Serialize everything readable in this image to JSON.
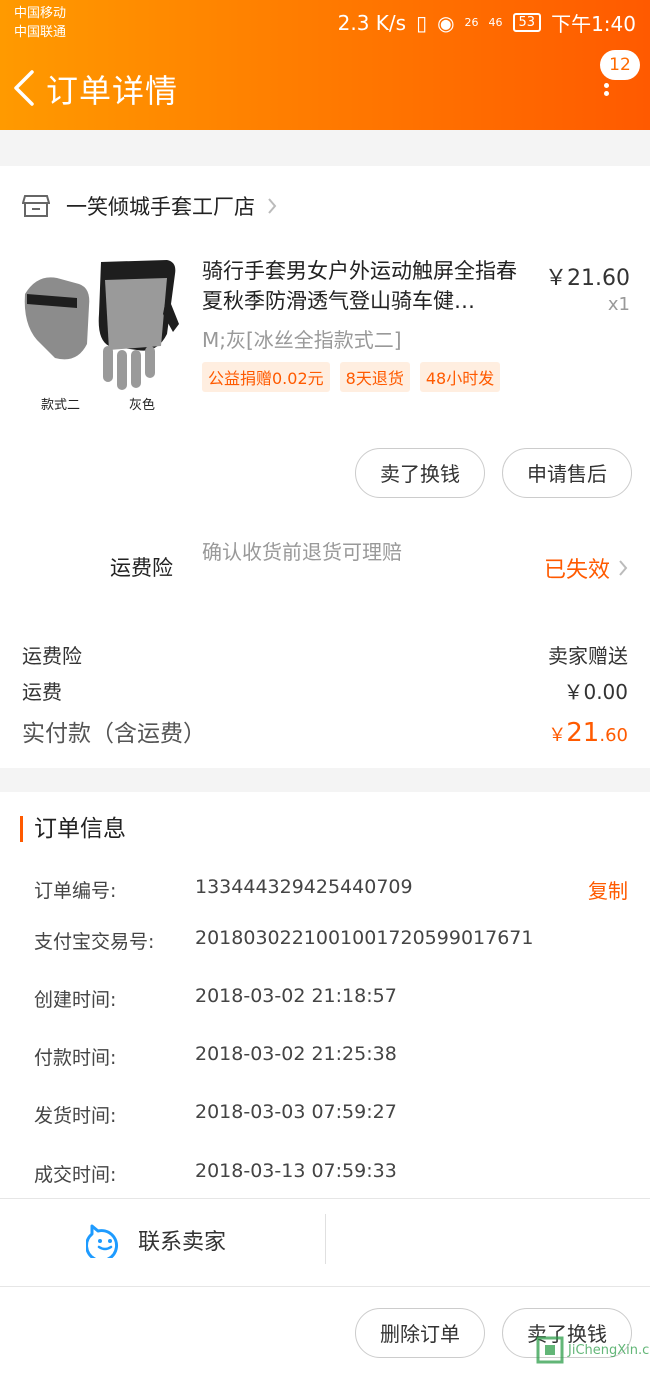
{
  "status_bar": {
    "carrier1": "中国移动",
    "carrier2": "中国联通",
    "speed": "2.3 K/s",
    "signal1": "26",
    "signal2": "46",
    "battery": "53",
    "time": "下午1:40"
  },
  "header": {
    "title": "订单详情",
    "badge": "12"
  },
  "shop": {
    "name": "一笑倾城手套工厂店"
  },
  "item": {
    "title": "骑行手套男女户外运动触屏全指春夏秋季防滑透气登山骑车健…",
    "price": "￥21.60",
    "qty": "x1",
    "spec": "M;灰[冰丝全指款式二]",
    "tags": [
      "公益捐赠0.02元",
      "8天退货",
      "48小时发"
    ],
    "thumb_caption1": "款式二",
    "thumb_caption2": "灰色"
  },
  "actions": {
    "sell": "卖了换钱",
    "after_sale": "申请售后"
  },
  "insurance": {
    "label": "运费险",
    "desc": "确认收货前退货可理赔",
    "status": "已失效"
  },
  "summary": {
    "ins_label": "运费险",
    "ins_val": "卖家赠送",
    "ship_label": "运费",
    "ship_val": "￥0.00",
    "total_label": "实付款（含运费）",
    "total_currency": "￥",
    "total_int": "21",
    "total_dec": ".60"
  },
  "order_info": {
    "heading": "订单信息",
    "copy": "复制",
    "rows": [
      {
        "label": "订单编号:",
        "value": "133444329425440709"
      },
      {
        "label": "支付宝交易号:",
        "value": "2018030221001001720599017671"
      },
      {
        "label": "创建时间:",
        "value": "2018-03-02 21:18:57"
      },
      {
        "label": "付款时间:",
        "value": "2018-03-02 21:25:38"
      },
      {
        "label": "发货时间:",
        "value": "2018-03-03 07:59:27"
      },
      {
        "label": "成交时间:",
        "value": "2018-03-13 07:59:33"
      }
    ]
  },
  "contact": {
    "label": "联系卖家"
  },
  "bottom": {
    "delete": "删除订单",
    "sell": "卖了换钱"
  },
  "watermark": {
    "text": "JiChengXin.com"
  },
  "colors": {
    "accent": "#ff5a00",
    "header_start": "#ff9a00",
    "header_end": "#ff5a00"
  }
}
